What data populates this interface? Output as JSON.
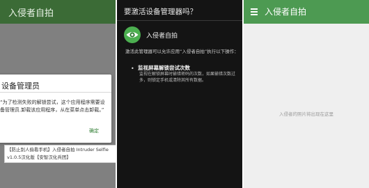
{
  "left": {
    "app_title": "入侵者自拍",
    "dialog": {
      "title": "设备管理员",
      "body": "“为了检测失败的解锁尝试，这个应用程序需要设备管理员.卸载该应用程序，从在菜单点击卸载。”",
      "ok_label": "确定"
    },
    "caption": {
      "line1": "【防止别人偷看手机】入侵者自拍 Intruder Selfie",
      "line2": "v1.0.5汉化版【安智汉化兵团】"
    }
  },
  "middle": {
    "question": "要激活设备管理器吗？",
    "app_name": "入侵者自拍",
    "description": "激活此管理器可以允许应用“入侵者自拍”执行以下操作：",
    "policy": {
      "title": "监视屏幕解锁尝试次数",
      "description": "监视在解锁屏幕时输错密码的次数，如果输错次数过多，则锁定手机或清除其所有数据。"
    }
  },
  "right": {
    "app_title": "入侵者自拍",
    "empty_text": "入侵者的照片将出现在这里"
  },
  "colors": {
    "toolbar_dark": "#3b6b36",
    "toolbar_green": "#4d9a52",
    "accent": "#2e7d32"
  }
}
